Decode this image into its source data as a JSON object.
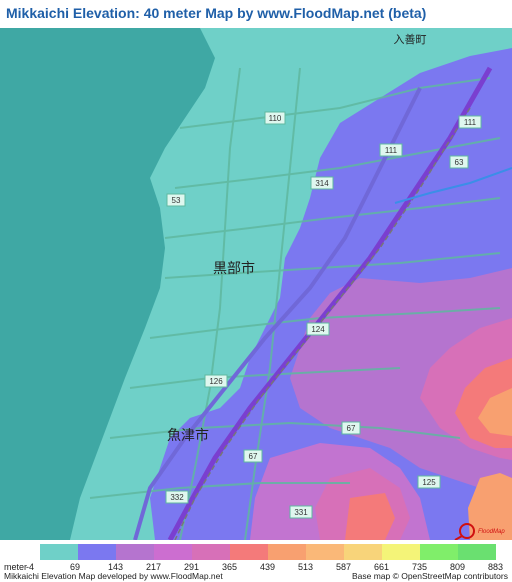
{
  "title": "Mikkaichi Elevation: 40 meter Map by www.FloodMap.net (beta)",
  "map": {
    "places": [
      {
        "id": "nyuzen",
        "text": "入善町"
      },
      {
        "id": "kurobe",
        "text": "黒部市"
      },
      {
        "id": "uozu",
        "text": "魚津市"
      }
    ],
    "routes": [
      "110",
      "111",
      "111",
      "63",
      "314",
      "53",
      "124",
      "126",
      "67",
      "67",
      "332",
      "331",
      "125"
    ],
    "colors": {
      "sea": "#3fa8a4",
      "lowland": "#6fd0c8",
      "road": "#5fb8a0",
      "railway": "#777777"
    }
  },
  "legend": {
    "unit": "meter",
    "ticks": [
      "-4",
      "69",
      "143",
      "217",
      "291",
      "365",
      "439",
      "513",
      "587",
      "661",
      "735",
      "809",
      "883"
    ],
    "colors": [
      "#6fd0c8",
      "#7b78f0",
      "#b574cf",
      "#cc6ed0",
      "#d770b8",
      "#f47a7a",
      "#f8a070",
      "#fab878",
      "#f8d47a",
      "#f4f478",
      "#80ee6a",
      "#6ae070"
    ]
  },
  "marker": {
    "label": "FloodMap"
  },
  "footer": {
    "left": "Mikkaichi Elevation Map developed by www.FloodMap.net",
    "right": "Base map © OpenStreetMap contributors"
  }
}
